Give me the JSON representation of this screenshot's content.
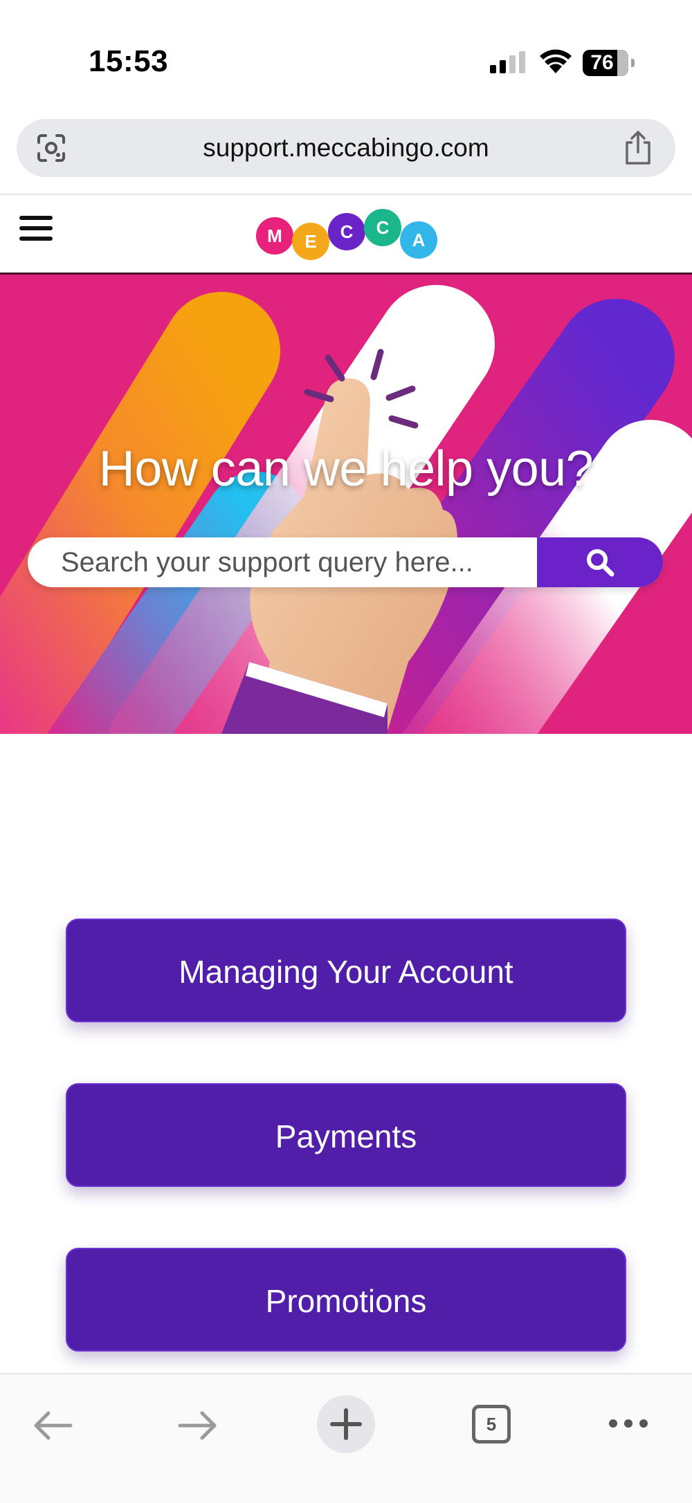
{
  "status_bar": {
    "time": "15:53",
    "battery": "76"
  },
  "browser": {
    "url": "support.meccabingo.com",
    "tab_count": "5"
  },
  "header": {
    "logo_letters": [
      "M",
      "E",
      "C",
      "C",
      "A"
    ],
    "logo_colors": [
      "#e8217a",
      "#f5a71b",
      "#6a22c9",
      "#1bb78a",
      "#32b6ea"
    ]
  },
  "hero": {
    "title": "How can we help you?",
    "search_placeholder": "Search your support query here..."
  },
  "categories": [
    {
      "label": "Managing Your Account"
    },
    {
      "label": "Payments"
    },
    {
      "label": "Promotions"
    }
  ],
  "colors": {
    "brand_purple": "#501ea8",
    "hero_pink": "#e0247e",
    "search_button": "#6a22c9"
  }
}
